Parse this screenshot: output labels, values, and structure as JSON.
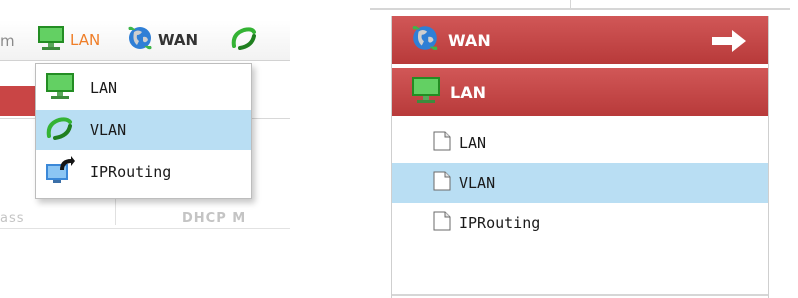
{
  "menubar": {
    "cut_left_text": "m",
    "items": [
      {
        "label": "LAN",
        "icon": "monitor-icon"
      },
      {
        "label": "WAN",
        "icon": "globe-icon"
      },
      {
        "label": "",
        "icon": "vlan-swirl-icon"
      }
    ],
    "active_color": "#ef7e28"
  },
  "dropdown": {
    "items": [
      {
        "label": "LAN",
        "icon": "monitor-icon"
      },
      {
        "label": "VLAN",
        "icon": "vlan-swirl-icon"
      },
      {
        "label": "IPRouting",
        "icon": "routing-icon"
      }
    ],
    "selected_index": 1
  },
  "background_table": {
    "col_a": "ass",
    "col_b": "DHCP M"
  },
  "side_panel": {
    "headers": [
      {
        "label": "WAN",
        "icon": "globe-icon"
      },
      {
        "label": "LAN",
        "icon": "monitor-icon"
      }
    ],
    "tree_items": [
      {
        "label": "LAN",
        "icon": "document-icon"
      },
      {
        "label": "VLAN",
        "icon": "document-icon"
      },
      {
        "label": "IPRouting",
        "icon": "document-icon"
      }
    ],
    "selected_index": 1,
    "header_color": "#c64848",
    "selection_color": "#b9def3"
  }
}
